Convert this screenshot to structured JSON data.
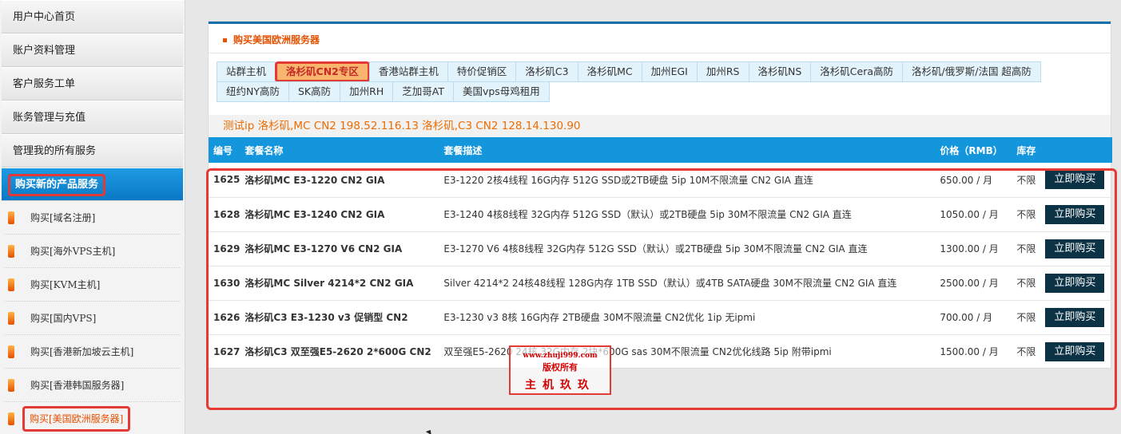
{
  "sidebar": {
    "items": [
      {
        "label": "用户中心首页"
      },
      {
        "label": "账户资料管理"
      },
      {
        "label": "客户服务工单"
      },
      {
        "label": "账务管理与充值"
      },
      {
        "label": "管理我的所有服务"
      },
      {
        "label": "购买新的产品服务"
      }
    ],
    "sub_items": [
      {
        "label": "购买[域名注册]"
      },
      {
        "label": "购买[海外VPS主机]"
      },
      {
        "label": "购买[KVM主机]"
      },
      {
        "label": "购买[国内VPS]"
      },
      {
        "label": "购买[香港新加坡云主机]"
      },
      {
        "label": "购买[香港韩国服务器]"
      },
      {
        "label": "购买[美国欧洲服务器]"
      }
    ]
  },
  "panel": {
    "title": "购买美国欧洲服务器",
    "tabs": [
      {
        "label": "站群主机"
      },
      {
        "label": "洛杉矶CN2专区"
      },
      {
        "label": "香港站群主机"
      },
      {
        "label": "特价促销区"
      },
      {
        "label": "洛杉矶C3"
      },
      {
        "label": "洛杉矶MC"
      },
      {
        "label": "加州EGI"
      },
      {
        "label": "加州RS"
      },
      {
        "label": "洛杉矶NS"
      },
      {
        "label": "洛杉矶Cera高防"
      },
      {
        "label": "洛杉矶/俄罗斯/法国 超高防"
      },
      {
        "label": "纽约NY高防"
      },
      {
        "label": "SK高防"
      },
      {
        "label": "加州RH"
      },
      {
        "label": "芝加哥AT"
      },
      {
        "label": "美国vps母鸡租用"
      }
    ],
    "test_ip": "测试ip 洛杉矶,MC CN2 198.52.116.13 洛杉矶,C3 CN2 128.14.130.90"
  },
  "table": {
    "headers": {
      "id": "编号",
      "name": "套餐名称",
      "desc": "套餐描述",
      "price": "价格（RMB）",
      "stock": "库存"
    },
    "buy_label": "立即购买",
    "rows": [
      {
        "id": "1625",
        "name": "洛杉矶MC E3-1220 CN2 GIA",
        "desc": "E3-1220 2核4线程 16G内存 512G SSD或2TB硬盘  5ip  10M不限流量 CN2 GIA 直连",
        "price": "650.00 / 月",
        "stock": "不限"
      },
      {
        "id": "1628",
        "name": "洛杉矶MC E3-1240 CN2 GIA",
        "desc": "E3-1240 4核8线程 32G内存 512G SSD（默认）或2TB硬盘  5ip  30M不限流量 CN2 GIA 直连",
        "price": "1050.00 / 月",
        "stock": "不限"
      },
      {
        "id": "1629",
        "name": "洛杉矶MC E3-1270 V6 CN2 GIA",
        "desc": "E3-1270 V6 4核8线程 32G内存 512G SSD（默认）或2TB硬盘  5ip  30M不限流量 CN2 GIA 直连",
        "price": "1300.00 / 月",
        "stock": "不限"
      },
      {
        "id": "1630",
        "name": "洛杉矶MC Silver 4214*2 CN2 GIA",
        "desc": "Silver 4214*2 24核48线程 128G内存 1TB SSD（默认）或4TB SATA硬盘 30M不限流量 CN2 GIA 直连",
        "price": "2500.00 / 月",
        "stock": "不限"
      },
      {
        "id": "1626",
        "name": "洛杉矶C3 E3-1230 v3 促销型 CN2",
        "desc": "E3-1230 v3 8核 16G内存 2TB硬盘 30M不限流量 CN2优化 1ip 无ipmi",
        "price": "700.00 / 月",
        "stock": "不限"
      },
      {
        "id": "1627",
        "name": "洛杉矶C3 双至强E5-2620 2*600G CN2",
        "desc": "双至强E5-2620 24核 32G内存 2块*600G sas  30M不限流量 CN2优化线路 5ip 附带ipmi",
        "price": "1500.00 / 月",
        "stock": "不限"
      }
    ]
  },
  "watermark": {
    "line1": "www.zhuji999.com",
    "line2": "版权所有",
    "line3": "主机玖玖"
  }
}
